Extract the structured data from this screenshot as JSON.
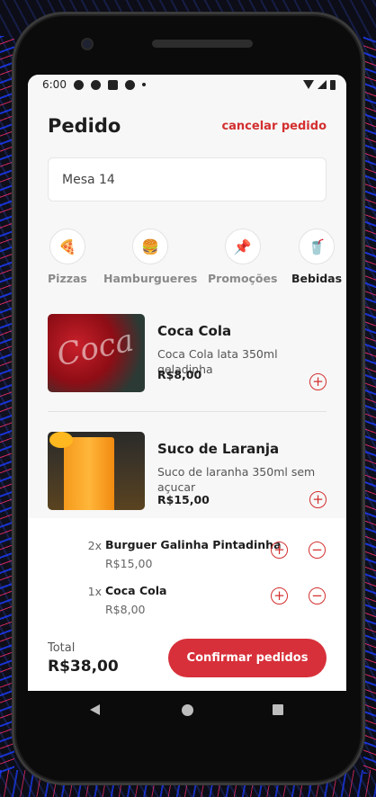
{
  "statusbar": {
    "time": "6:00"
  },
  "header": {
    "title": "Pedido",
    "cancel_label": "cancelar pedido"
  },
  "table_field": {
    "value": "Mesa 14"
  },
  "categories": [
    {
      "label": "Pizzas",
      "icon": "pizza-icon",
      "active": false
    },
    {
      "label": "Hamburgueres",
      "icon": "burger-icon",
      "active": false
    },
    {
      "label": "Promoções",
      "icon": "pin-icon",
      "active": false
    },
    {
      "label": "Bebidas",
      "icon": "drink-icon",
      "active": true
    }
  ],
  "products": [
    {
      "name": "Coca Cola",
      "description": "Coca Cola lata 350ml geladinha",
      "price": "R$8,00"
    },
    {
      "name": "Suco de Laranja",
      "description": "Suco de laranha 350ml sem açucar",
      "price": "R$15,00"
    }
  ],
  "order": {
    "items": [
      {
        "qty": "2x",
        "name": "Burguer Galinha Pintadinha",
        "price": "R$15,00"
      },
      {
        "qty": "1x",
        "name": "Coca Cola",
        "price": "R$8,00"
      }
    ],
    "total_label": "Total",
    "total_value": "R$38,00",
    "confirm_label": "Confirmar pedidos"
  },
  "colors": {
    "accent": "#d7303a",
    "background": "#f7f7f7",
    "text": "#1d1d1d"
  }
}
